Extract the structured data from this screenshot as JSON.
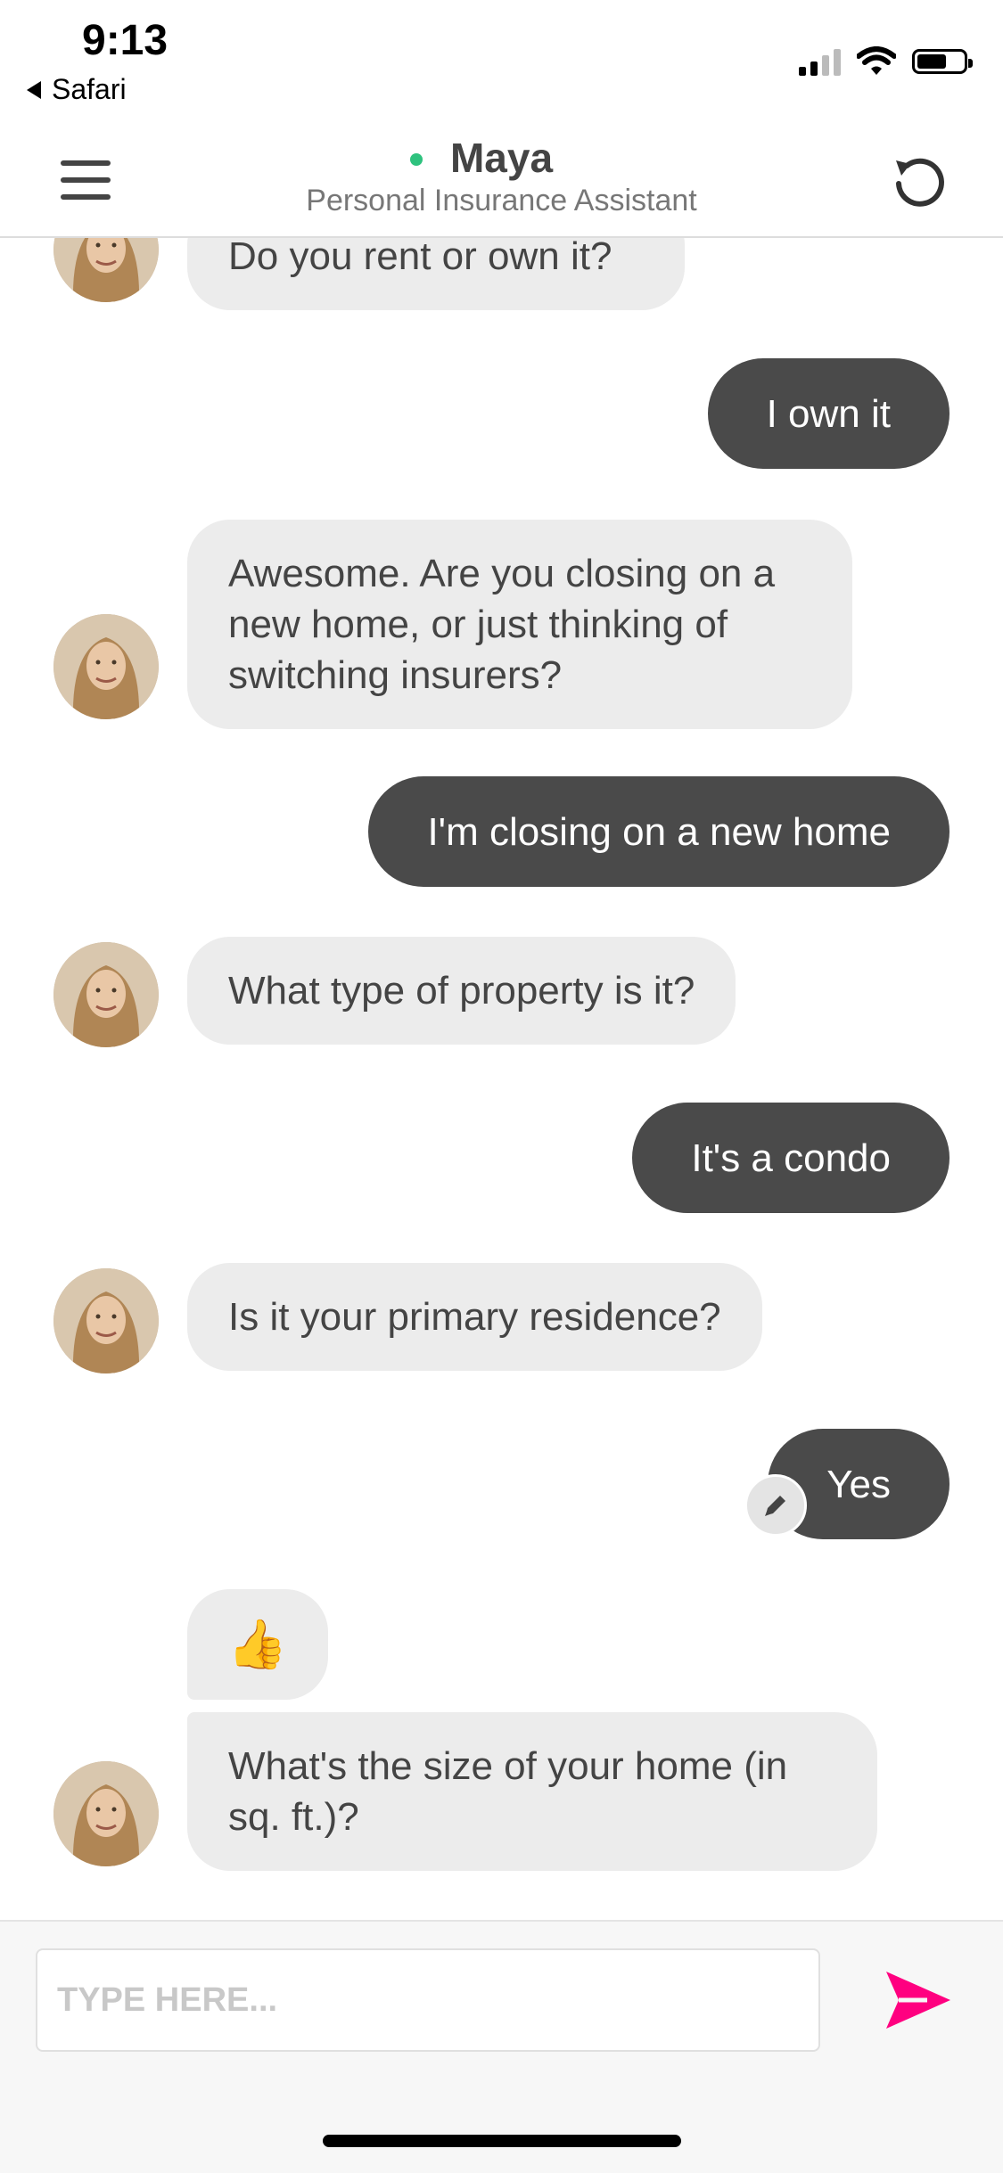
{
  "status_bar": {
    "time": "9:13",
    "back_app": "Safari",
    "battery_level": 0.6
  },
  "header": {
    "name": "Maya",
    "subtitle": "Personal Insurance Assistant",
    "online": true
  },
  "messages": [
    {
      "from": "bot",
      "text": "Do you rent or own it?"
    },
    {
      "from": "user",
      "text": "I own it"
    },
    {
      "from": "bot",
      "text": "Awesome. Are you closing on a new home, or just thinking of switching insurers?"
    },
    {
      "from": "user",
      "text": "I'm closing on a new home"
    },
    {
      "from": "bot",
      "text": "What type of property is it?"
    },
    {
      "from": "user",
      "text": "It's a condo"
    },
    {
      "from": "bot",
      "text": "Is it your primary residence?"
    },
    {
      "from": "user",
      "text": "Yes"
    },
    {
      "from": "bot",
      "text": "👍"
    },
    {
      "from": "bot",
      "text": "What's the size of your home (in sq. ft.)?"
    }
  ],
  "composer": {
    "placeholder": "TYPE HERE...",
    "value": ""
  },
  "colors": {
    "accent": "#ff0080",
    "online": "#2ec27e",
    "user_bubble": "#4a4a4a",
    "bot_bubble": "#ececec"
  },
  "icons": {
    "menu": "hamburger-icon",
    "restart": "restart-icon",
    "edit": "pencil-icon",
    "send": "send-icon"
  }
}
